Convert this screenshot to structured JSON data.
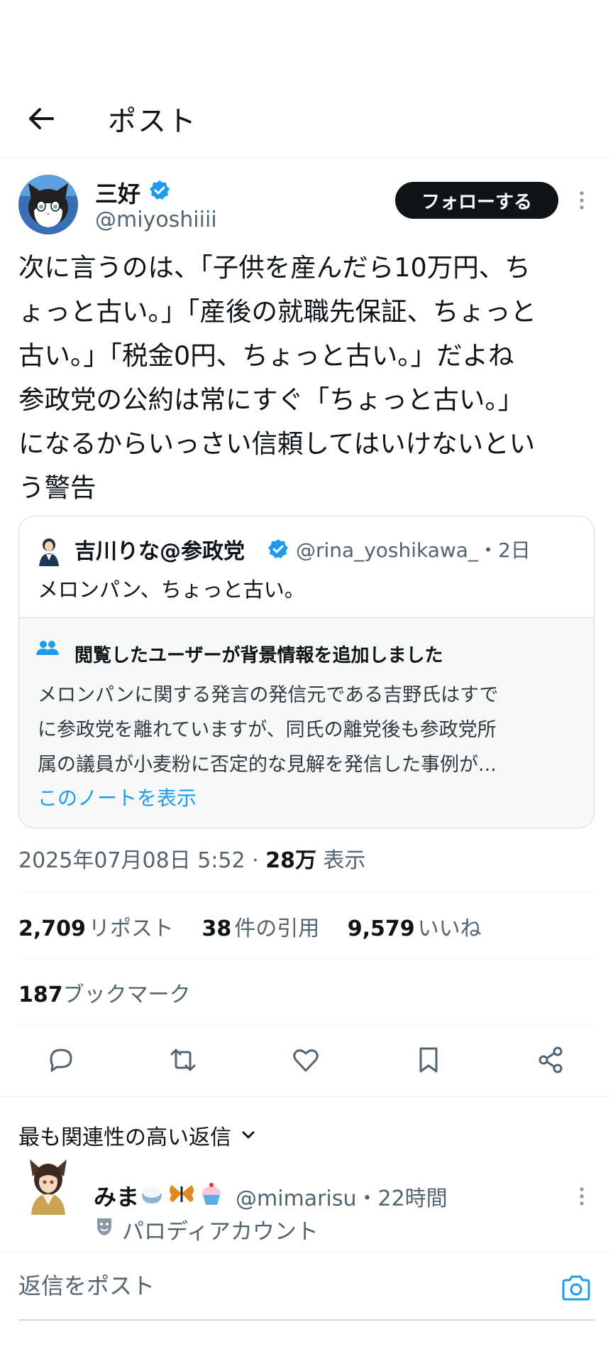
{
  "header": {
    "title": "ポスト"
  },
  "author": {
    "name": "三好",
    "handle": "@miyoshiiii",
    "follow_label": "フォローする"
  },
  "tweet": {
    "text": "次に言うのは、「子供を産んだら10万円、ち\nょっと古い。」「産後の就職先保証、ちょっと\n古い。」「税金0円、ちょっと古い。」だよね\n参政党の公約は常にすぐ「ちょっと古い。」\nになるからいっさい信頼してはいけないとい\nう警告"
  },
  "quote": {
    "name": "吉川りな@参政党",
    "handle": "@rina_yoshikawa_",
    "time": "・2日",
    "text": "メロンパン、ちょっと古い。",
    "note_title": "閲覧したユーザーが背景情報を追加しました",
    "note_text": "メロンパンに関する発言の発信元である吉野氏はすで\nに参政党を離れていますが、同氏の離党後も参政党所\n属の議員が小麦粉に否定的な見解を発信した事例が...",
    "note_link": "このノートを表示"
  },
  "meta": {
    "timestamp": "2025年07月08日 5:52",
    "views_count": "28万",
    "views_label": "表示"
  },
  "stats": {
    "reposts": "2,709",
    "reposts_label": "リポスト",
    "quotes": "38",
    "quotes_label": "件の引用",
    "likes": "9,579",
    "likes_label": "いいね",
    "bookmarks": "187",
    "bookmarks_label": "ブックマーク"
  },
  "replies": {
    "sort_label": "最も関連性の高い返信",
    "first": {
      "name": "みま",
      "emoji_icons": [
        "rice-bowl-icon",
        "butterfly-icon",
        "cupcake-icon"
      ],
      "handle": "@mimarisu",
      "time": "・22時間",
      "badge": "パロディアカウント"
    }
  },
  "composer": {
    "placeholder": "返信をポスト"
  },
  "colors": {
    "accent": "#1d9bf0",
    "text": "#0f1419",
    "secondary": "#536471",
    "border": "#cfd9de"
  }
}
